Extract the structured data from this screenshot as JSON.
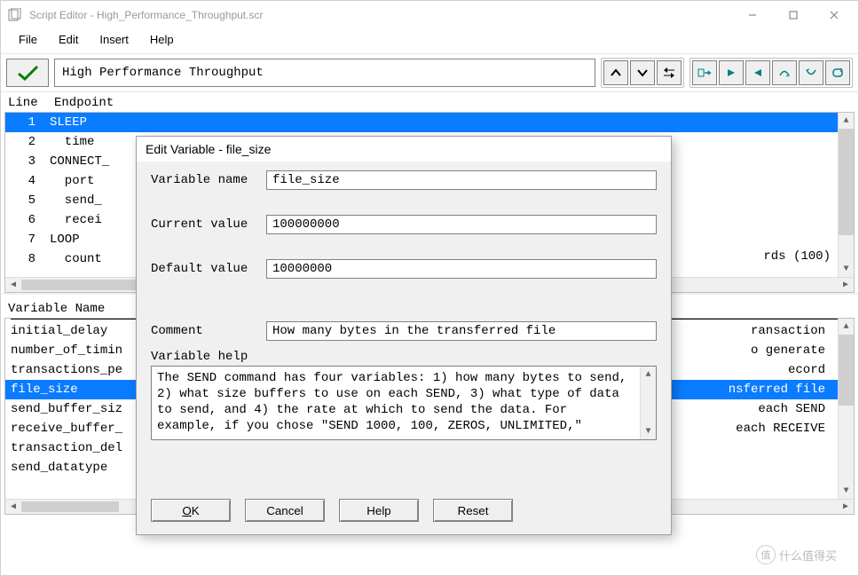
{
  "window": {
    "title": "Script Editor - High_Performance_Throughput.scr"
  },
  "menu": {
    "file": "File",
    "edit": "Edit",
    "insert": "Insert",
    "help": "Help"
  },
  "script_name": "High Performance Throughput",
  "top": {
    "header_line": "Line",
    "header_ep": "Endpoint",
    "rows": [
      {
        "n": "1",
        "txt": "SLEEP"
      },
      {
        "n": "2",
        "txt": "  time"
      },
      {
        "n": "3",
        "txt": "CONNECT_"
      },
      {
        "n": "4",
        "txt": "  port"
      },
      {
        "n": "5",
        "txt": "  send_"
      },
      {
        "n": "6",
        "txt": "  recei"
      },
      {
        "n": "7",
        "txt": "LOOP"
      },
      {
        "n": "8",
        "txt": "  count"
      }
    ],
    "tail_right": "rds (100)"
  },
  "bottom": {
    "header": "Variable Name",
    "rows": [
      {
        "name": "initial_delay",
        "tail": "ransaction"
      },
      {
        "name": "number_of_timin",
        "tail": "o generate"
      },
      {
        "name": "transactions_pe",
        "tail": "ecord"
      },
      {
        "name": "file_size",
        "tail": "nsferred file"
      },
      {
        "name": "send_buffer_siz",
        "tail": "each SEND"
      },
      {
        "name": "receive_buffer_",
        "tail": "each RECEIVE"
      },
      {
        "name": "transaction_del",
        "tail": ""
      },
      {
        "name": "send_datatype",
        "tail": ""
      }
    ]
  },
  "dialog": {
    "title": "Edit Variable - file_size",
    "labels": {
      "varname": "Variable name",
      "curval": "Current value",
      "defval": "Default value",
      "comment": "Comment",
      "help": "Variable help"
    },
    "varname": "file_size",
    "curval": "100000000",
    "defval": "10000000",
    "comment": "How many bytes in the transferred file",
    "help": "The SEND command has four variables: 1) how many bytes to send, 2) what size buffers to use on each SEND, 3) what type of data to send, and 4) the rate at which to send the data. For example, if you chose \"SEND 1000, 100, ZEROS, UNLIMITED,\"",
    "buttons": {
      "ok": "OK",
      "cancel": "Cancel",
      "help": "Help",
      "reset": "Reset"
    }
  },
  "watermark": "什么值得买"
}
